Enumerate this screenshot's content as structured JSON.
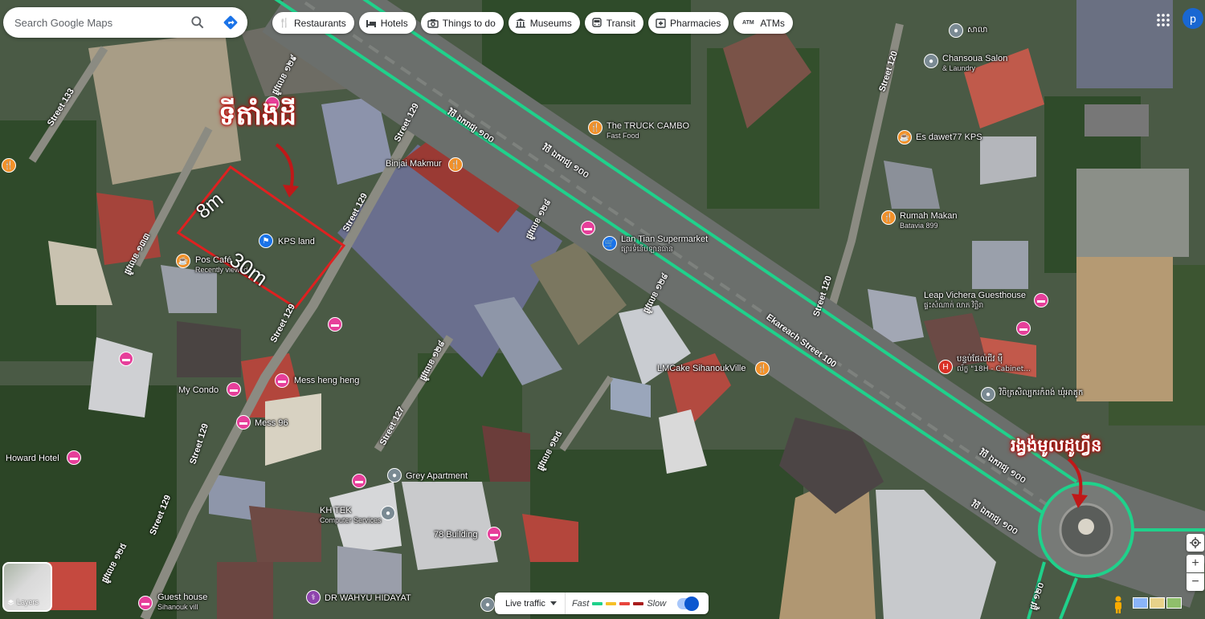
{
  "search": {
    "placeholder": "Search Google Maps"
  },
  "chips": [
    {
      "label": "Restaurants",
      "icon": "fork-knife-icon"
    },
    {
      "label": "Hotels",
      "icon": "bed-icon"
    },
    {
      "label": "Things to do",
      "icon": "camera-icon"
    },
    {
      "label": "Museums",
      "icon": "museum-icon"
    },
    {
      "label": "Transit",
      "icon": "bus-icon"
    },
    {
      "label": "Pharmacies",
      "icon": "pharmacy-icon"
    },
    {
      "label": "ATMs",
      "icon": "atm-icon"
    }
  ],
  "atm_badge": "ATM",
  "user": {
    "avatar_letter": "p"
  },
  "annotations": {
    "land_title": "ទីតាំងដី",
    "roundabout_title": "រង្វង់មូលដូហ្វីន",
    "width": "8m",
    "length": "30m",
    "land_outline_color": "#e02020"
  },
  "roads": {
    "main_khmer": "វិថី ឯករាជ្យ ១០០",
    "ekareach": "Ekareach Street 100",
    "st129": "Street 129",
    "st127": "Street 127",
    "st133": "Street 133",
    "st120": "Street 120",
    "st_khmer_129": "ផ្លូវលេខ ១២៩",
    "st_khmer_128": "ផ្លូវលេខ ១២៨",
    "st_khmer_125": "ផ្លូវលេខ ១២៥",
    "st_khmer_133": "ផ្លូវលេខ ១៣៣",
    "st_khmer_120": "ផ្លូវ ១២០"
  },
  "places": [
    {
      "name": "The TRUCK CAMBO",
      "sub": "Fast Food",
      "type": "food"
    },
    {
      "name": "Binjai Makmur",
      "sub": "",
      "type": "food"
    },
    {
      "name": "Es dawet77 KPS",
      "sub": "",
      "type": "food"
    },
    {
      "name": "Rumah Makan",
      "sub": "Batavia 899",
      "type": "food"
    },
    {
      "name": "Chansoua Salon",
      "sub": "& Laundry",
      "type": "grey"
    },
    {
      "name": "Lan Tian Supermarket",
      "sub": "ផ្សារទំនើបឡានធាន",
      "type": "blue"
    },
    {
      "name": "KPS land",
      "sub": "",
      "type": "blue"
    },
    {
      "name": "Pos Café",
      "sub": "Recently viewed",
      "type": "food"
    },
    {
      "name": "Leap Vichera Guesthouse",
      "sub": "ផ្ទះសំណាក់ លាភ វិច្ឆិរា",
      "type": "hotel"
    },
    {
      "name": "បន្ទប់ផែល់ជីវ ម៉ឺ",
      "sub": "ល័ក្ខ \"18H - Cabinet...",
      "type": "red"
    },
    {
      "name": "វិចិត្រសិល្បករកំពង់ ឃុំអាតូក",
      "sub": "",
      "type": "grey"
    },
    {
      "name": "LMCake SihanoukVille",
      "sub": "",
      "type": "food"
    },
    {
      "name": "Mess heng heng",
      "sub": "",
      "type": "hotel"
    },
    {
      "name": "My Condo",
      "sub": "",
      "type": "hotel"
    },
    {
      "name": "Mess 96",
      "sub": "",
      "type": "hotel"
    },
    {
      "name": "Howard Hotel",
      "sub": "",
      "type": "hotel"
    },
    {
      "name": "Grey Apartment",
      "sub": "",
      "type": "grey"
    },
    {
      "name": "KH TEK",
      "sub": "Computer Services",
      "type": "grey"
    },
    {
      "name": "78 Building",
      "sub": "",
      "type": "hotel"
    },
    {
      "name": "Guest house",
      "sub": "Sihanouk vill",
      "type": "hotel"
    },
    {
      "name": "DR WAHYU HIDAYAT",
      "sub": "",
      "type": "purple"
    },
    {
      "name": "សាលា",
      "sub": "",
      "type": "grey"
    }
  ],
  "layers": {
    "label": "Layers"
  },
  "traffic": {
    "live_label": "Live traffic",
    "fast": "Fast",
    "slow": "Slow",
    "colors": [
      "#1fd18b",
      "#f6c026",
      "#e8453c",
      "#a81c1c"
    ]
  },
  "controls": {
    "zoom_in": "+",
    "zoom_out": "−"
  }
}
